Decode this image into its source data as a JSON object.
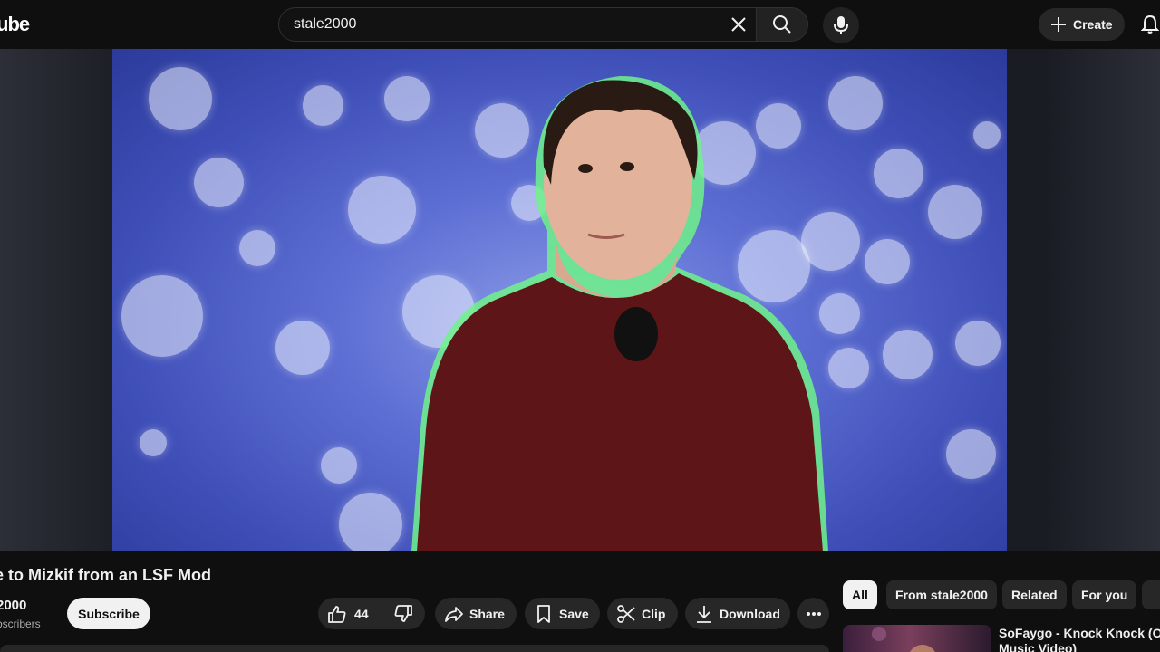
{
  "header": {
    "logo_text": "ube",
    "search_value": "stale2000",
    "create_label": "Create",
    "icons": [
      "youtube-logo",
      "clear-icon",
      "search-icon",
      "mic-icon",
      "plus-icon",
      "bell-icon"
    ]
  },
  "video": {
    "title": "e to Mizkif from an LSF Mod",
    "accent_color": "#5d6fd4"
  },
  "channel": {
    "name": "2000",
    "subscribers": "bscribers",
    "subscribe_label": "Subscribe"
  },
  "actions": {
    "like_count": "44",
    "share_label": "Share",
    "save_label": "Save",
    "clip_label": "Clip",
    "download_label": "Download"
  },
  "sidebar": {
    "chips": [
      {
        "label": "All",
        "active": true
      },
      {
        "label": "From stale2000",
        "active": false
      },
      {
        "label": "Related",
        "active": false
      },
      {
        "label": "For you",
        "active": false
      }
    ],
    "recommendations": [
      {
        "title": "SoFaygo - Knock Knock (Offic",
        "subtitle": "Music Video)"
      }
    ]
  }
}
